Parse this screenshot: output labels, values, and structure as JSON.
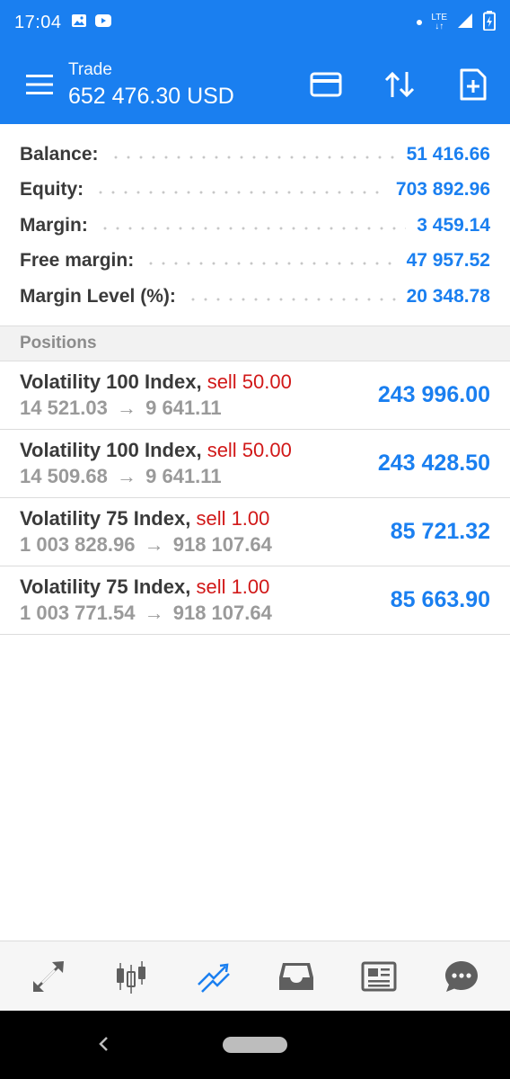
{
  "status_bar": {
    "time": "17:04",
    "network": "LTE"
  },
  "app_bar": {
    "title": "Trade",
    "subtitle": "652 476.30 USD"
  },
  "summary": [
    {
      "label": "Balance:",
      "value": "51 416.66"
    },
    {
      "label": "Equity:",
      "value": "703 892.96"
    },
    {
      "label": "Margin:",
      "value": "3 459.14"
    },
    {
      "label": "Free margin:",
      "value": "47 957.52"
    },
    {
      "label": "Margin Level (%):",
      "value": "20 348.78"
    }
  ],
  "positions_header": "Positions",
  "positions": [
    {
      "symbol": "Volatility 100 Index,",
      "side": "sell 50.00",
      "open_price": "14 521.03",
      "arrow": "→",
      "current_price": "9 641.11",
      "profit": "243 996.00"
    },
    {
      "symbol": "Volatility 100 Index,",
      "side": "sell 50.00",
      "open_price": "14 509.68",
      "arrow": "→",
      "current_price": "9 641.11",
      "profit": "243 428.50"
    },
    {
      "symbol": "Volatility 75 Index,",
      "side": "sell 1.00",
      "open_price": "1 003 828.96",
      "arrow": "→",
      "current_price": "918 107.64",
      "profit": "85 721.32"
    },
    {
      "symbol": "Volatility 75 Index,",
      "side": "sell 1.00",
      "open_price": "1 003 771.54",
      "arrow": "→",
      "current_price": "918 107.64",
      "profit": "85 663.90"
    }
  ],
  "bottom_nav": [
    {
      "icon": "quotes-icon",
      "active": false
    },
    {
      "icon": "chart-icon",
      "active": false
    },
    {
      "icon": "trade-icon",
      "active": true
    },
    {
      "icon": "history-icon",
      "active": false
    },
    {
      "icon": "news-icon",
      "active": false
    },
    {
      "icon": "chat-icon",
      "active": false
    }
  ],
  "colors": {
    "accent": "#1a7ff0",
    "sell": "#d11818",
    "muted": "#9a9a9a",
    "label": "#3a3a3a"
  }
}
